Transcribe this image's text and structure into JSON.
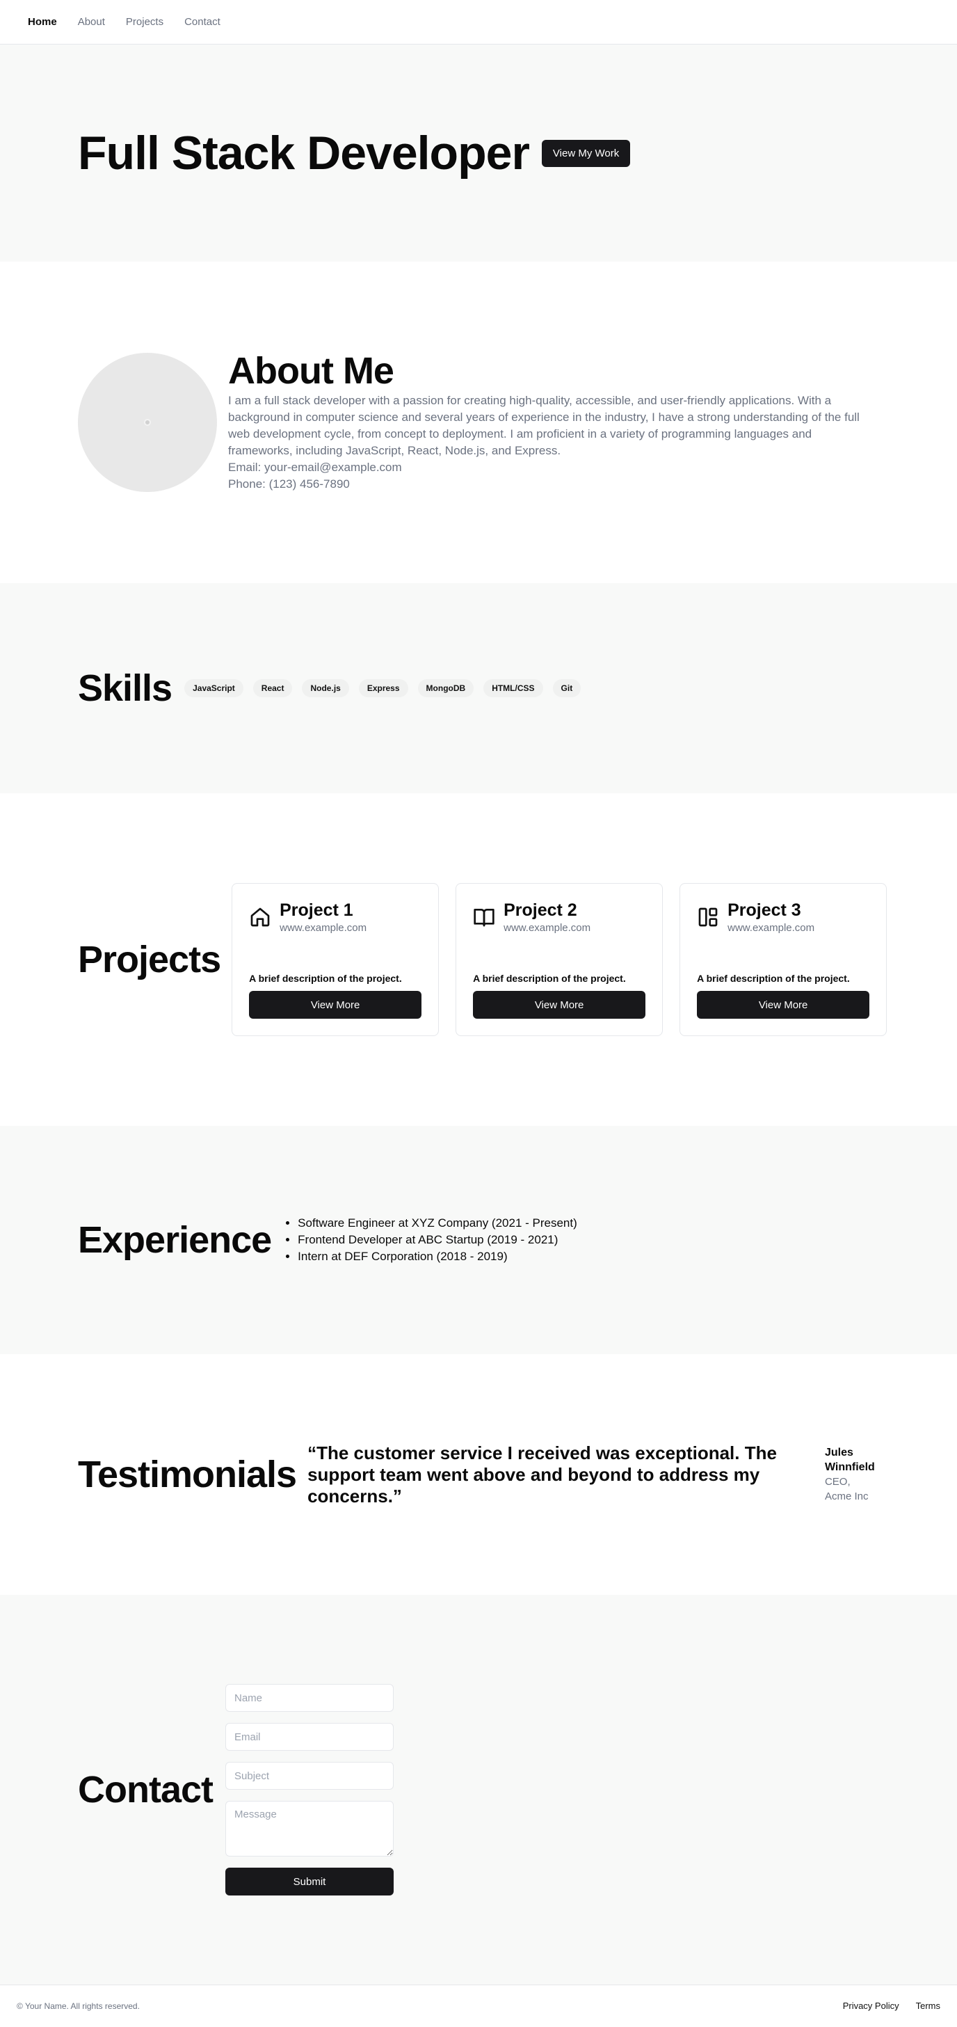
{
  "nav": {
    "items": [
      "Home",
      "About",
      "Projects",
      "Contact"
    ],
    "active": "Home"
  },
  "hero": {
    "title": "Full Stack Developer",
    "button": "View My Work"
  },
  "about": {
    "title": "About Me",
    "bio": "I am a full stack developer with a passion for creating high-quality, accessible, and user-friendly applications. With a background in computer science and several years of experience in the industry, I have a strong understanding of the full web development cycle, from concept to deployment. I am proficient in a variety of programming languages and frameworks, including JavaScript, React, Node.js, and Express.",
    "email": "Email: your-email@example.com",
    "phone": "Phone: (123) 456-7890"
  },
  "skills": {
    "title": "Skills",
    "items": [
      "JavaScript",
      "React",
      "Node.js",
      "Express",
      "MongoDB",
      "HTML/CSS",
      "Git"
    ]
  },
  "projects": {
    "title": "Projects",
    "items": [
      {
        "icon": "home-icon",
        "title": "Project 1",
        "url": "www.example.com",
        "description": "A brief description of the project.",
        "button": "View More"
      },
      {
        "icon": "book-open-icon",
        "title": "Project 2",
        "url": "www.example.com",
        "description": "A brief description of the project.",
        "button": "View More"
      },
      {
        "icon": "layout-icon",
        "title": "Project 3",
        "url": "www.example.com",
        "description": "A brief description of the project.",
        "button": "View More"
      }
    ]
  },
  "experience": {
    "title": "Experience",
    "items": [
      "Software Engineer at XYZ Company (2021 - Present)",
      "Frontend Developer at ABC Startup (2019 - 2021)",
      "Intern at DEF Corporation (2018 - 2019)"
    ]
  },
  "testimonials": {
    "title": "Testimonials",
    "quote": "“The customer service I received was exceptional. The support team went above and beyond to address my concerns.”",
    "author": "Jules Winnfield",
    "role": "CEO, Acme Inc"
  },
  "contact": {
    "title": "Contact",
    "name_placeholder": "Name",
    "email_placeholder": "Email",
    "subject_placeholder": "Subject",
    "message_placeholder": "Message",
    "submit": "Submit"
  },
  "footer": {
    "copyright": "© Your Name. All rights reserved.",
    "links": [
      "Privacy Policy",
      "Terms"
    ]
  }
}
